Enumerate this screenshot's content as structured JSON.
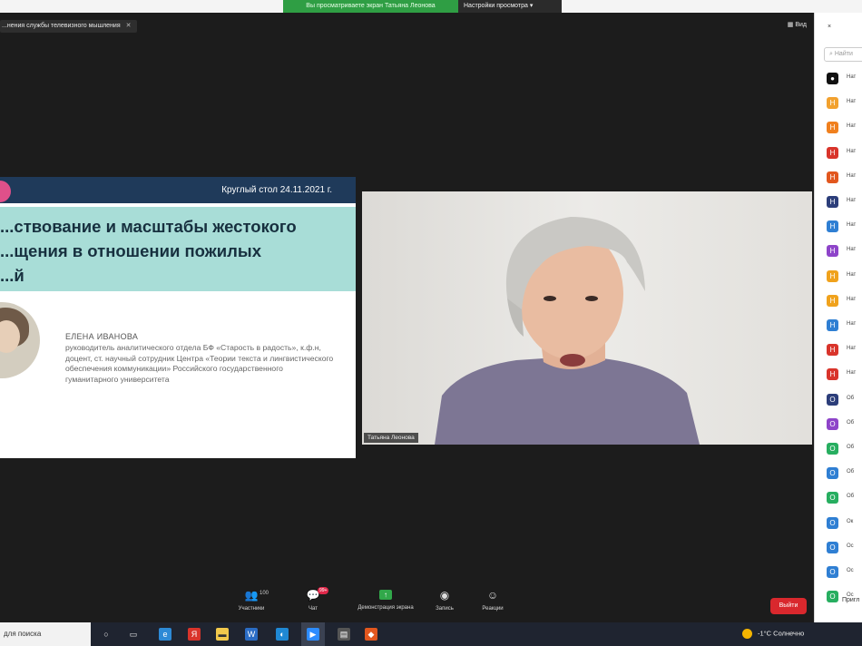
{
  "top_banner": {
    "viewing_text": "Вы просматриваете экран Татьяна Леонова",
    "view_options": "Настройки просмотра"
  },
  "share_tab": {
    "label": "...нения службы телевизного мышления"
  },
  "view_button": "Вид",
  "slide": {
    "date": "Круглый стол 24.11.2021 г.",
    "title_lines": [
      "...ствование и масштабы жестокого",
      "...щения в отношении пожилых",
      "...й"
    ],
    "speaker_name": "ЕЛЕНА ИВАНОВА",
    "speaker_desc": "руководитель аналитического отдела БФ «Старость в радость», к.ф.н, доцент, ст. научный сотрудник Центра «Теории текста и лингвистического обеспечения коммуникации» Российского государственного гуманитарного университета"
  },
  "video": {
    "participant_name": "Татьяна Леонова"
  },
  "toolbar": {
    "participants_label": "Участники",
    "participants_count": "100",
    "chat_label": "Чат",
    "chat_badge": "99+",
    "share_label": "Демонстрация экрана",
    "record_label": "Запись",
    "reactions_label": "Реакции",
    "leave_label": "Выйти"
  },
  "panel": {
    "close": "×",
    "search_placeholder": "Найти",
    "items": [
      {
        "label": "Нат",
        "color": "#111111",
        "letter": "●"
      },
      {
        "label": "Нат",
        "color": "#f2a12e",
        "letter": "Н"
      },
      {
        "label": "Нат",
        "color": "#f0801e",
        "letter": "Н"
      },
      {
        "label": "Нат",
        "color": "#d9342b",
        "letter": "Н"
      },
      {
        "label": "Нат",
        "color": "#e2571e",
        "letter": "Н"
      },
      {
        "label": "Нат",
        "color": "#2c3e7a",
        "letter": "Н"
      },
      {
        "label": "Нат",
        "color": "#2f7fd3",
        "letter": "Н"
      },
      {
        "label": "Нат",
        "color": "#8e44c9",
        "letter": "Н"
      },
      {
        "label": "Нат",
        "color": "#f0a21c",
        "letter": "Н"
      },
      {
        "label": "Нат",
        "color": "#f0a21c",
        "letter": "Н"
      },
      {
        "label": "Нат",
        "color": "#2f7fd3",
        "letter": "Н"
      },
      {
        "label": "Нат",
        "color": "#d9342b",
        "letter": "Н"
      },
      {
        "label": "Нат",
        "color": "#d9342b",
        "letter": "Н"
      },
      {
        "label": "Об",
        "color": "#2c3e7a",
        "letter": "О"
      },
      {
        "label": "Об",
        "color": "#8e44c9",
        "letter": "О"
      },
      {
        "label": "Об",
        "color": "#27ae60",
        "letter": "О"
      },
      {
        "label": "Об",
        "color": "#2f7fd3",
        "letter": "О"
      },
      {
        "label": "Об",
        "color": "#27ae60",
        "letter": "О"
      },
      {
        "label": "Ок",
        "color": "#2f7fd3",
        "letter": "О"
      },
      {
        "label": "Ос",
        "color": "#2f7fd3",
        "letter": "О"
      },
      {
        "label": "Ос",
        "color": "#2f7fd3",
        "letter": "О"
      },
      {
        "label": "Ос",
        "color": "#27ae60",
        "letter": "О"
      }
    ],
    "bottom_label": "Пригл"
  },
  "taskbar": {
    "search_text": "для поиска",
    "weather": "-1°С  Солнечно"
  }
}
